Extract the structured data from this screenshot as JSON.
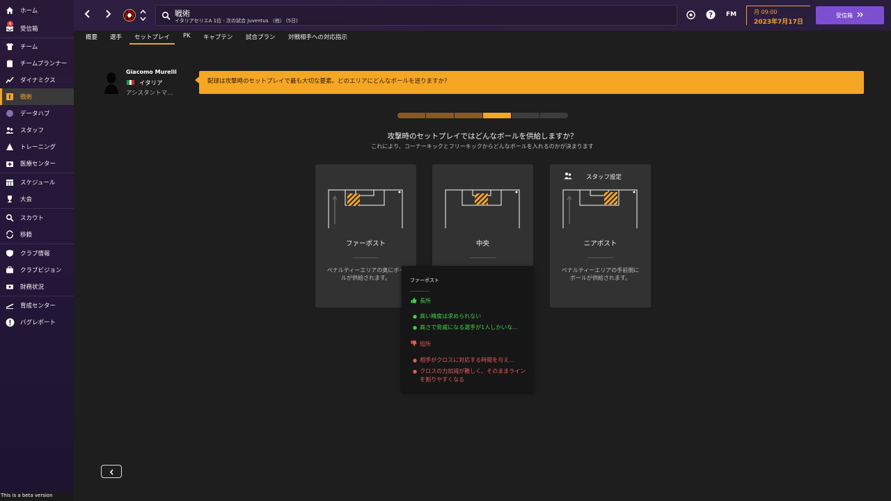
{
  "sidebar": {
    "items": [
      {
        "label": "ホーム",
        "icon": "home-icon"
      },
      {
        "label": "受信箱",
        "icon": "inbox-icon",
        "badge": "4"
      },
      {
        "label": "チーム",
        "icon": "shirt-icon"
      },
      {
        "label": "チームプランナー",
        "icon": "clipboard-icon"
      },
      {
        "label": "ダイナミクス",
        "icon": "dynamics-icon"
      },
      {
        "label": "戦術",
        "icon": "tactics-icon",
        "active": true
      },
      {
        "label": "データハブ",
        "icon": "data-hub-icon"
      },
      {
        "label": "スタッフ",
        "icon": "staff-icon"
      },
      {
        "label": "トレーニング",
        "icon": "training-icon"
      },
      {
        "label": "医療センター",
        "icon": "medical-icon"
      },
      {
        "label": "スケジュール",
        "icon": "calendar-icon"
      },
      {
        "label": "大会",
        "icon": "trophy-icon"
      },
      {
        "label": "スカウト",
        "icon": "scout-icon"
      },
      {
        "label": "移籍",
        "icon": "transfer-icon"
      },
      {
        "label": "クラブ情報",
        "icon": "shield-icon"
      },
      {
        "label": "クラブビジョン",
        "icon": "briefcase-icon"
      },
      {
        "label": "財務状況",
        "icon": "finance-icon"
      },
      {
        "label": "育成センター",
        "icon": "youth-icon"
      },
      {
        "label": "バグレポート",
        "icon": "bug-report-icon"
      }
    ],
    "beta_note": "This is a beta version"
  },
  "topbar": {
    "search_title": "戦術",
    "search_subtitle": "イタリアセリエA 1位 - 次の試合 Juventus （他） (5日)",
    "fm_logo": "FM",
    "date_time": "月 09:00",
    "date_day": "2023年7月17日",
    "inbox_button": "受信箱",
    "accent": "#7c4fd0"
  },
  "tabs": [
    "概要",
    "選手",
    "セットプレイ",
    "PK",
    "キャプテン",
    "試合プラン",
    "対戦相手への対応指示"
  ],
  "active_tab": "セットプレイ",
  "assistant": {
    "name": "Giacomo Murelli",
    "nationality": "イタリア",
    "role": "アシスタントマ...",
    "message": "配球は攻撃時のセットプレイで最も大切な要素。どのエリアにどんなボールを送りますか？"
  },
  "progress": {
    "total_steps": 6,
    "current_step": 4
  },
  "question": {
    "title": "攻撃時のセットプレイではどんなボールを供給しますか？",
    "subtitle": "これにより、コーナーキックとフリーキックからどんなボールを入れるのかが決まります"
  },
  "options": [
    {
      "name": "ファーポスト",
      "description": "ペナルティーエリアの奥にボールが供給されます。"
    },
    {
      "name": "中央",
      "description": ""
    },
    {
      "name": "ニアポスト",
      "description": "ペナルティーエリアの手前側にボールが供給されます。",
      "staff_setting": "スタッフ設定"
    }
  ],
  "tooltip": {
    "title": "ファーポスト",
    "pros_label": "長所",
    "pros": [
      "高い精度は求められない",
      "高さで脅威になる選手が1人しかいな..."
    ],
    "cons_label": "短所",
    "cons": [
      "相手がクロスに対応する時間を与え...",
      "クロスの力加減が難しく、そのままラインを割りやすくなる"
    ]
  },
  "colors": {
    "accent": "#f5a623",
    "pro": "#43d04a",
    "con": "#e65a5a"
  }
}
